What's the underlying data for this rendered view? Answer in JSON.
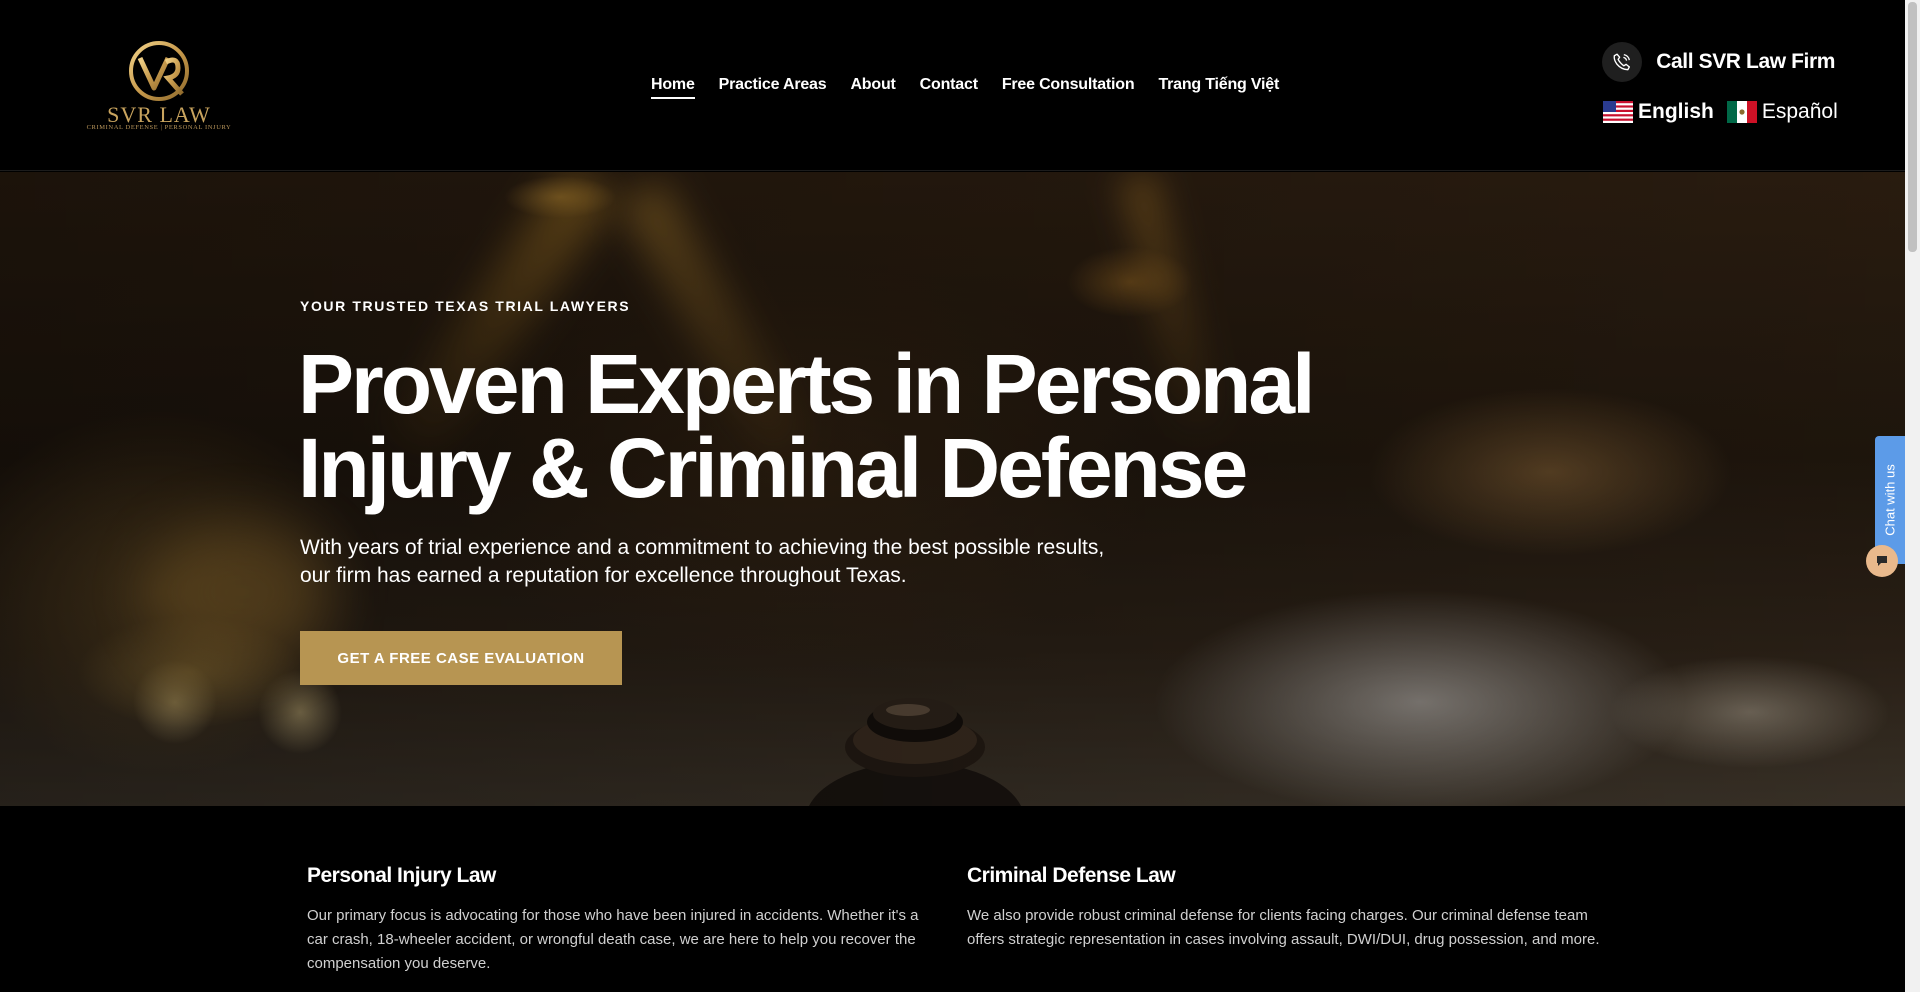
{
  "header": {
    "logo": {
      "brand": "SVR LAW",
      "tagline": "CRIMINAL DEFENSE | PERSONAL INJURY",
      "icon": "svr-monogram-logo"
    },
    "nav": [
      {
        "label": "Home",
        "active": true
      },
      {
        "label": "Practice Areas",
        "active": false
      },
      {
        "label": "About",
        "active": false
      },
      {
        "label": "Contact",
        "active": false
      },
      {
        "label": "Free Consultation",
        "active": false
      },
      {
        "label": "Trang Tiếng Việt",
        "active": false
      }
    ],
    "call": {
      "label": "Call SVR Law Firm",
      "icon": "phone-icon"
    },
    "languages": [
      {
        "label": "English",
        "flag": "us-flag-icon",
        "selected": true
      },
      {
        "label": "Español",
        "flag": "mexico-flag-icon",
        "selected": false
      }
    ]
  },
  "hero": {
    "eyebrow": "YOUR TRUSTED TEXAS TRIAL LAWYERS",
    "headline_line1": "Proven Experts in Personal",
    "headline_line2": "Injury & Criminal Defense",
    "subtext_line1": "With years of trial experience and a commitment to achieving the best possible results,",
    "subtext_line2": "our firm has earned a reputation for excellence throughout Texas.",
    "cta_label": "GET A FREE CASE EVALUATION"
  },
  "practice_areas": [
    {
      "title": "Personal Injury Law",
      "description": "Our primary focus is advocating for those who have been injured in accidents. Whether it's a car crash, 18-wheeler accident, or wrongful death case, we are here to help you recover the compensation you deserve."
    },
    {
      "title": "Criminal Defense Law",
      "description": "We also provide robust criminal defense for clients facing charges. Our criminal defense team offers strategic representation in cases involving assault, DWI/DUI, drug possession, and more."
    }
  ],
  "chat": {
    "tab_label": "Chat with us",
    "icon": "chat-bubble-icon"
  },
  "colors": {
    "accent": "#b79552",
    "chat": "#5c9be8",
    "background": "#000000"
  }
}
